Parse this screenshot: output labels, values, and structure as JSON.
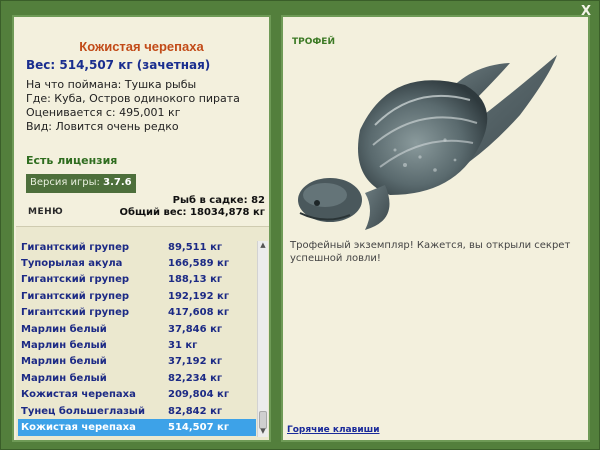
{
  "close_label": "X",
  "fish": {
    "title": "Кожистая черепаха",
    "weight_line": "Вес: 514,507 кг (зачетная)",
    "info": [
      "На что поймана: Тушка рыбы",
      "Где: Куба, Остров одинокого пирата",
      "Оценивается с: 495,001 кг",
      "Вид: Ловится очень редко"
    ]
  },
  "license": "Есть лицензия",
  "version": {
    "label": "Версия игры:",
    "value": "3.7.6"
  },
  "menu_label": "МЕНЮ",
  "stats": {
    "cage": "Рыб в садке: 82",
    "total": "Общий вес: 18034,878 кг"
  },
  "catches": [
    {
      "name": "Гигантский групер",
      "weight": "89,511 кг"
    },
    {
      "name": "Тупорылая акула",
      "weight": "166,589 кг"
    },
    {
      "name": "Гигантский групер",
      "weight": "188,13 кг"
    },
    {
      "name": "Гигантский групер",
      "weight": "192,192 кг"
    },
    {
      "name": "Гигантский групер",
      "weight": "417,608 кг"
    },
    {
      "name": "Марлин белый",
      "weight": "37,846 кг"
    },
    {
      "name": "Марлин белый",
      "weight": "31 кг"
    },
    {
      "name": "Марлин белый",
      "weight": "37,192 кг"
    },
    {
      "name": "Марлин белый",
      "weight": "82,234 кг"
    },
    {
      "name": "Кожистая черепаха",
      "weight": "209,804 кг"
    },
    {
      "name": "Тунец большеглазый",
      "weight": "82,842 кг"
    },
    {
      "name": "Кожистая черепаха",
      "weight": "514,507 кг"
    }
  ],
  "selected_index": 11,
  "trophy": {
    "label": "ТРОФЕЙ",
    "text": "Трофейный экземпляр! Кажется, вы открыли секрет успешной ловли!"
  },
  "hotkeys": "Горячие клавиши",
  "colors": {
    "background": "#537f3c",
    "panel": "#f3f0dd",
    "selected_row": "#3da2e8",
    "fish_title": "#c24b18"
  }
}
